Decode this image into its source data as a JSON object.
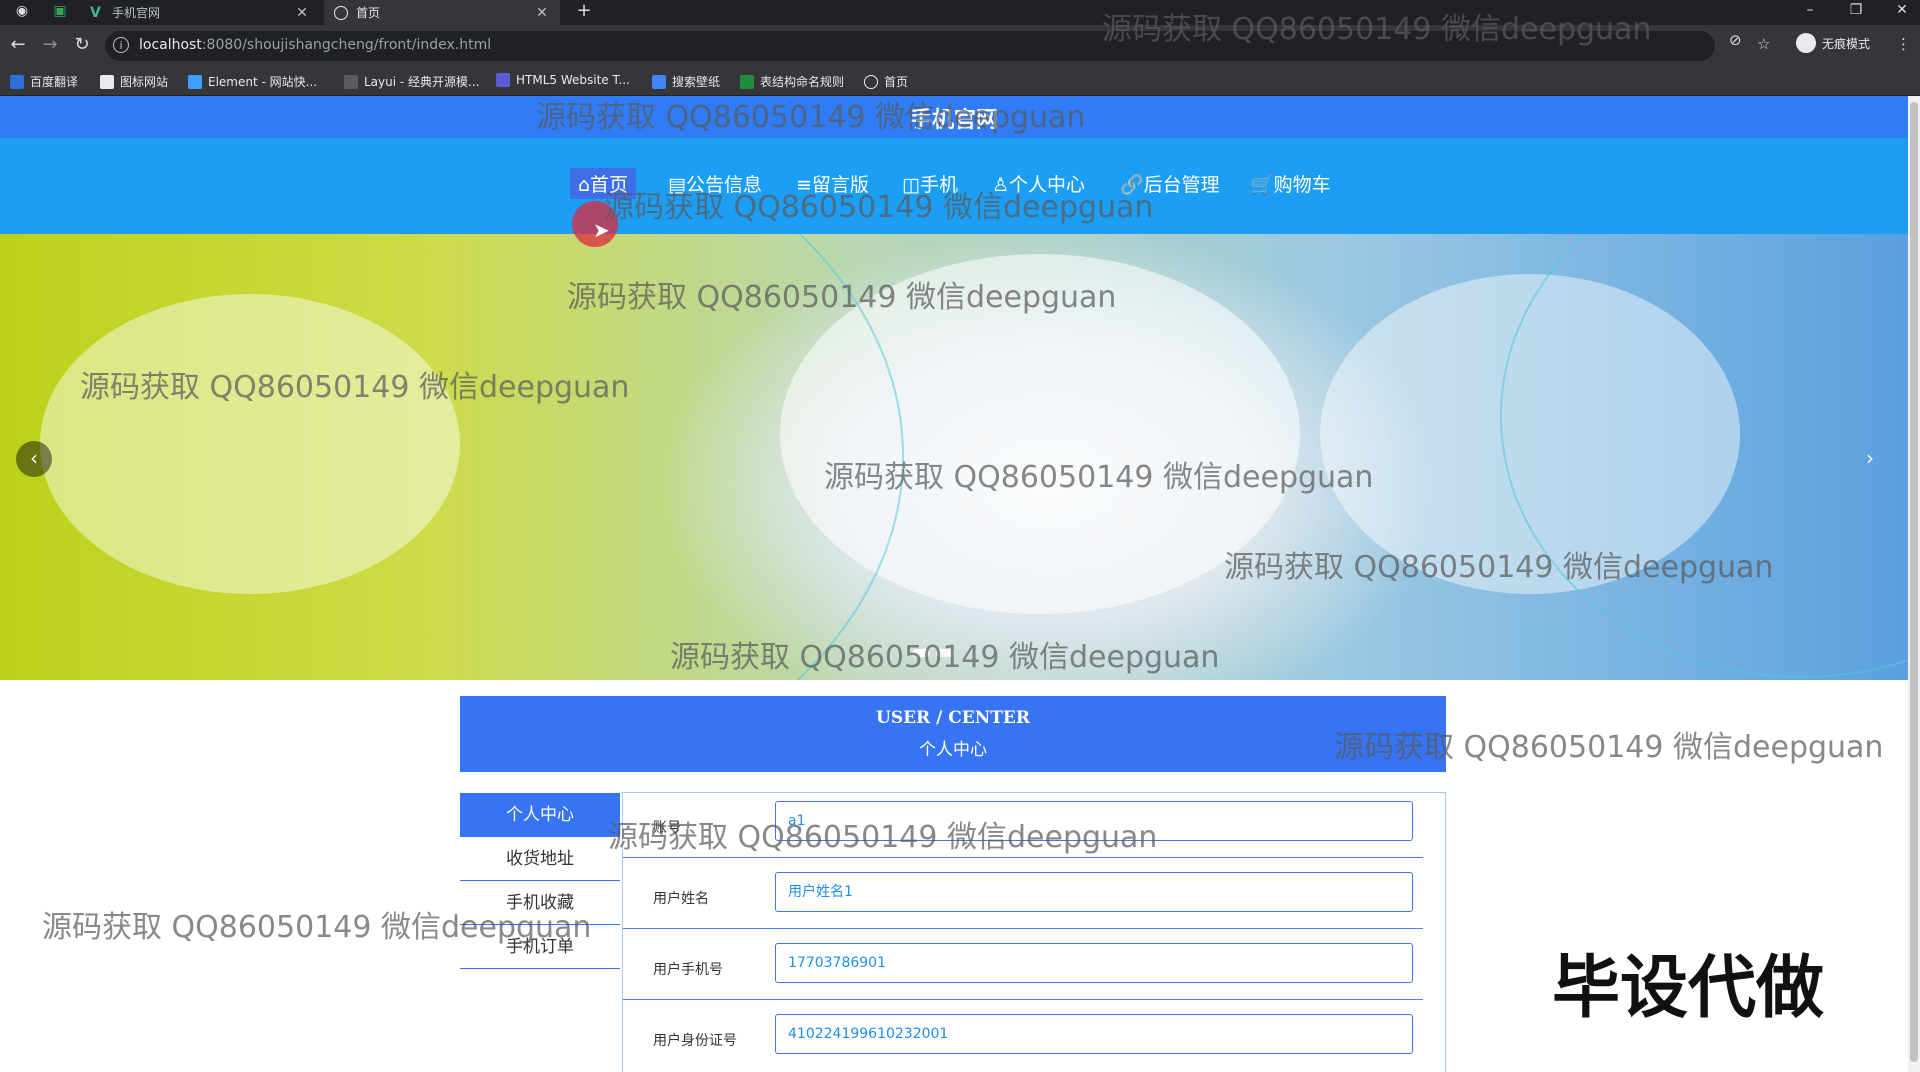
{
  "browser": {
    "tabs": [
      {
        "title": "手机官网",
        "active": false
      },
      {
        "title": "首页",
        "active": true
      }
    ],
    "url_host": "localhost",
    "url_path": ":8080/shoujishangcheng/front/index.html",
    "profile_label": "无痕模式",
    "bookmarks": [
      "百度翻译",
      "图标网站",
      "Element - 网站快...",
      "Layui - 经典开源模...",
      "HTML5 Website T...",
      "搜索壁纸",
      "表结构命名规则",
      "首页"
    ]
  },
  "site": {
    "title": "手机官网",
    "nav": [
      "⌂首页",
      "▤公告信息",
      "≡留言版",
      "◫手机",
      "♙个人中心",
      "🔗后台管理",
      "🛒购物车"
    ],
    "active_nav_index": 0
  },
  "user_center": {
    "title_en": "USER / CENTER",
    "title_cn": "个人中心"
  },
  "side_menu": [
    "个人中心",
    "收货地址",
    "手机收藏",
    "手机订单"
  ],
  "form": {
    "fields": [
      {
        "label": "账号",
        "value": "a1"
      },
      {
        "label": "用户姓名",
        "value": "用户姓名1"
      },
      {
        "label": "用户手机号",
        "value": "17703786901"
      },
      {
        "label": "用户身份证号",
        "value": "410224199610232001"
      }
    ]
  },
  "watermark_text": "源码获取 QQ86050149 微信deepguan",
  "promo_text": "毕设代做",
  "colors": {
    "primary": "#3674f3",
    "nav_bg": "#1c9ef5",
    "top_bg": "#2f7cf6"
  }
}
